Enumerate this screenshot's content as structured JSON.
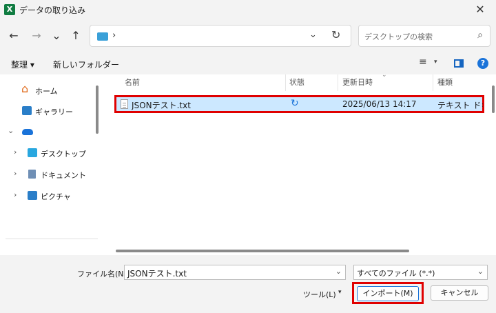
{
  "window": {
    "title": "データの取り込み",
    "app_icon": "X",
    "close_glyph": "✕"
  },
  "nav": {
    "back": "←",
    "forward": "→",
    "recent": "⌄",
    "up": "↑"
  },
  "address": {
    "separator": "›",
    "dropdown": "⌄",
    "refresh": "↻"
  },
  "search": {
    "placeholder": "デスクトップの検索",
    "icon": "⌕"
  },
  "commands": {
    "organize": "整理 ▾",
    "new_folder": "新しいフォルダー",
    "view_icon": "≡",
    "view_drop": "▾",
    "help": "?"
  },
  "sidebar": {
    "items": [
      {
        "label": "ホーム",
        "icon": "home-icon"
      },
      {
        "label": "ギャラリー",
        "icon": "gallery-icon"
      },
      {
        "label": "",
        "icon": "onedrive-icon"
      },
      {
        "label": "デスクトップ",
        "icon": "desktop-folder-icon"
      },
      {
        "label": "ドキュメント",
        "icon": "documents-folder-icon"
      },
      {
        "label": "ピクチャ",
        "icon": "pictures-folder-icon"
      }
    ],
    "chevron_right": "›",
    "chevron_down": "⌄"
  },
  "columns": {
    "name": "名前",
    "status": "状態",
    "modified": "更新日時",
    "type": "種類",
    "sort_glyph": "⌄"
  },
  "files": [
    {
      "name": "JSONテスト.txt",
      "status_icon": "sync-icon",
      "status_glyph": "↻",
      "modified": "2025/06/13 14:17",
      "type": "テキスト ドキュメント"
    }
  ],
  "footer": {
    "filename_label": "ファイル名(N):",
    "filename_value": "JSONテスト.txt",
    "filetype_value": "すべてのファイル (*.*)",
    "dropdown": "⌄",
    "tools_label": "ツール(L)",
    "tools_drop": "▾",
    "import_label": "インポート(M)",
    "cancel_label": "キャンセル"
  },
  "colors": {
    "accent": "#1a73d9",
    "highlight_border": "#e00000",
    "selection": "#cce8ff",
    "excel_green": "#107c41"
  }
}
